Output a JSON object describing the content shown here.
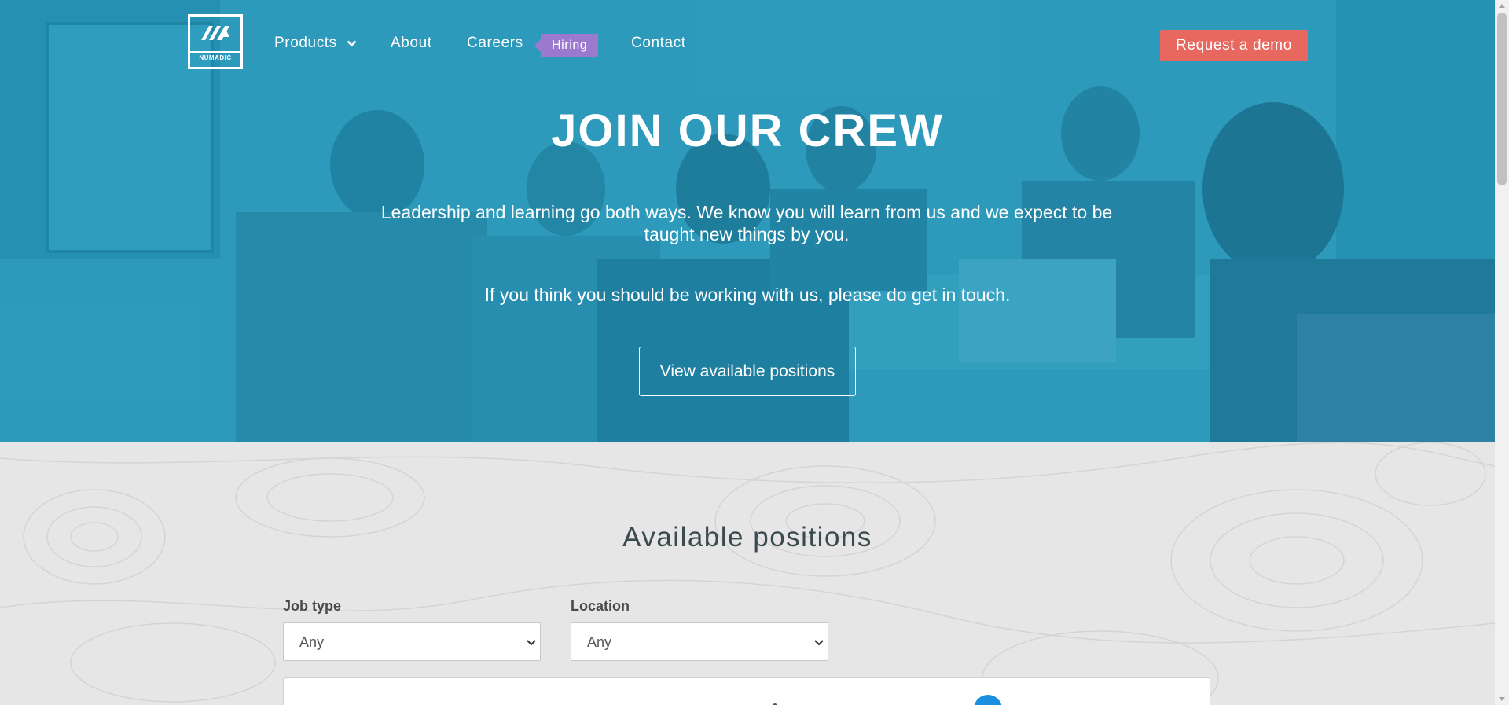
{
  "brand": {
    "name": "NUMADIC"
  },
  "nav": {
    "products": "Products",
    "about": "About",
    "careers": "Careers",
    "careers_badge": "Hiring",
    "contact": "Contact",
    "cta": "Request a demo"
  },
  "hero": {
    "title": "JOIN OUR CREW",
    "subtitle": "Leadership and learning go both ways. We know you will learn from us and we expect to be taught new things by you.",
    "subtitle2": "If you think you should be working with us, please do get in touch.",
    "button": "View available positions"
  },
  "positions": {
    "title": "Available positions",
    "filters": {
      "job_type": {
        "label": "Job type",
        "value": "Any"
      },
      "location": {
        "label": "Location",
        "value": "Any"
      }
    }
  },
  "colors": {
    "hero_tint": "#2f93b2",
    "cta": "#e8675e",
    "badge": "#9b79cf",
    "link": "#2691d9"
  },
  "icons": [
    "chevron-down-icon",
    "numadic-logo-icon",
    "dropdown-caret-icon"
  ]
}
